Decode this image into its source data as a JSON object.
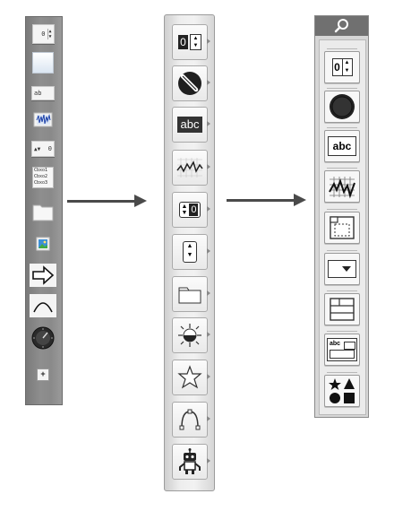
{
  "palette_old": {
    "items": [
      {
        "name": "numeric-control",
        "text": "0"
      },
      {
        "name": "blank-panel"
      },
      {
        "name": "string-control",
        "text": "ab"
      },
      {
        "name": "waveform-graph"
      },
      {
        "name": "ring-control",
        "text": "0"
      },
      {
        "name": "listbox",
        "text": "Cbxo1 Cbxo2 Cbxo3"
      },
      {
        "name": "folder"
      },
      {
        "name": "image"
      },
      {
        "name": "arrow"
      },
      {
        "name": "arc"
      },
      {
        "name": "knob"
      },
      {
        "name": "add",
        "text": "+"
      }
    ]
  },
  "palette_mid": {
    "items": [
      {
        "name": "numeric",
        "text": "0"
      },
      {
        "name": "boolean"
      },
      {
        "name": "string",
        "text": "abc"
      },
      {
        "name": "graph"
      },
      {
        "name": "ring-enum",
        "text": "0"
      },
      {
        "name": "spinner"
      },
      {
        "name": "container"
      },
      {
        "name": "decorations"
      },
      {
        "name": "star"
      },
      {
        "name": "path"
      },
      {
        "name": "robot"
      }
    ]
  },
  "palette_new": {
    "search_icon": "search-icon",
    "items": [
      {
        "name": "numeric",
        "text": "0"
      },
      {
        "name": "boolean"
      },
      {
        "name": "string",
        "text": "abc"
      },
      {
        "name": "graph"
      },
      {
        "name": "container"
      },
      {
        "name": "dropdown"
      },
      {
        "name": "layout"
      },
      {
        "name": "text-panel",
        "text": "abc"
      },
      {
        "name": "shapes"
      }
    ]
  },
  "colors": {
    "arrow": "#4a4a4a",
    "old_bg": "#8a8a8a",
    "new_head": "#707070"
  }
}
